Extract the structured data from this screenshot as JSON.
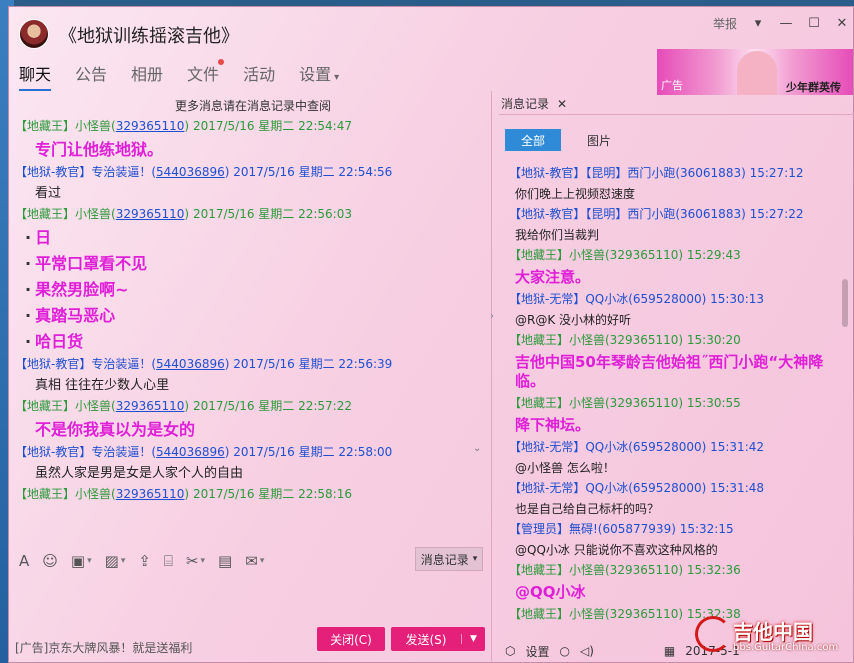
{
  "window": {
    "title": "《地狱训练摇滚吉他》",
    "report_label": "举报",
    "banner_ad": "广告",
    "banner_text": "少年群英传"
  },
  "nav": [
    {
      "label": "聊天"
    },
    {
      "label": "公告"
    },
    {
      "label": "相册"
    },
    {
      "label": "文件"
    },
    {
      "label": "活动"
    },
    {
      "label": "设置"
    }
  ],
  "chat": {
    "tip": "更多消息请在消息记录中查阅",
    "messages": [
      {
        "tag": "【地藏王】",
        "name": "小怪兽(",
        "qq": "329365110",
        "after": ")",
        "time": "2017/5/16 星期二 22:54:47",
        "text": "专门让他练地狱。",
        "style": "big"
      },
      {
        "tag": "【地狱-教官】",
        "name": "专治装逼！(",
        "qq": "544036896",
        "after": ")",
        "time": "2017/5/16 星期二 22:54:56",
        "text": "看过",
        "style": "normal"
      },
      {
        "tag": "【地藏王】",
        "name": "小怪兽(",
        "qq": "329365110",
        "after": ")",
        "time": "2017/5/16 星期二 22:56:03",
        "lines": [
          "日",
          "平常口罩看不见",
          "果然男脸啊~",
          "真踏马恶心",
          "哈日货"
        ],
        "style": "bullets"
      },
      {
        "tag": "【地狱-教官】",
        "name": "专治装逼！(",
        "qq": "544036896",
        "after": ")",
        "time": "2017/5/16 星期二 22:56:39",
        "text": "真相  往往在少数人心里",
        "style": "normal"
      },
      {
        "tag": "【地藏王】",
        "name": "小怪兽(",
        "qq": "329365110",
        "after": ")",
        "time": "2017/5/16 星期二 22:57:22",
        "text": "不是你我真以为是女的",
        "style": "big"
      },
      {
        "tag": "【地狱-教官】",
        "name": "专治装逼！(",
        "qq": "544036896",
        "after": ")",
        "time": "2017/5/16 星期二 22:58:00",
        "text": "虽然人家是男是女是人家个人的自由",
        "style": "normal"
      },
      {
        "tag": "【地藏王】",
        "name": "小怪兽(",
        "qq": "329365110",
        "after": ")",
        "time": "2017/5/16 星期二 22:58:16",
        "text": "",
        "style": "normal"
      }
    ]
  },
  "toolbar": {
    "history_label": "消息记录"
  },
  "footer": {
    "ad_text": "[广告]京东大牌风暴！就是送福利",
    "close_label": "关闭(C)",
    "send_label": "发送(S)"
  },
  "right_panel": {
    "tab_label": "消息记录",
    "filters": [
      "全部",
      "图片"
    ],
    "messages": [
      {
        "head": "【地狱-教官】【昆明】西门小跑(36061883) 15:27:12",
        "color": "blue",
        "text": "你们晚上上视频怼速度",
        "style": "normal"
      },
      {
        "head": "【地狱-教官】【昆明】西门小跑(36061883) 15:27:22",
        "color": "blue",
        "text": "我给你们当裁判",
        "style": "normal"
      },
      {
        "head": "【地藏王】小怪兽(329365110) 15:29:43",
        "color": "green",
        "text": "大家注意。",
        "style": "big"
      },
      {
        "head": "【地狱-无常】QQ小冰(659528000) 15:30:13",
        "color": "blue",
        "text": "@R@K 没小林的好听",
        "style": "normal"
      },
      {
        "head": "【地藏王】小怪兽(329365110) 15:30:20",
        "color": "green",
        "text": "吉他中国50年琴龄吉他始祖˝西门小跑“大神降临。",
        "style": "big"
      },
      {
        "head": "【地藏王】小怪兽(329365110) 15:30:55",
        "color": "green",
        "text": "降下神坛。",
        "style": "big"
      },
      {
        "head": "【地狱-无常】QQ小冰(659528000) 15:31:42",
        "color": "blue",
        "text": "@小怪兽 怎么啦！",
        "style": "normal"
      },
      {
        "head": "【地狱-无常】QQ小冰(659528000) 15:31:48",
        "color": "blue",
        "text": "也是自己给自己标杆的吗？",
        "style": "normal"
      },
      {
        "head": "【管理员】無碍!(605877939) 15:32:15",
        "color": "blue",
        "text": "@QQ小冰 只能说你不喜欢这种风格的",
        "style": "normal"
      },
      {
        "head": "【地藏王】小怪兽(329365110) 15:32:36",
        "color": "green",
        "text": "@QQ小冰",
        "style": "big"
      },
      {
        "head": "【地藏王】小怪兽(329365110) 15:32:38",
        "color": "green",
        "text": "",
        "style": "normal"
      }
    ],
    "bottom_settings": "设置",
    "bottom_date": "2017-5-1"
  },
  "watermark": {
    "brand": "吉他中国",
    "url": "bbs.GuitarChina.com"
  }
}
